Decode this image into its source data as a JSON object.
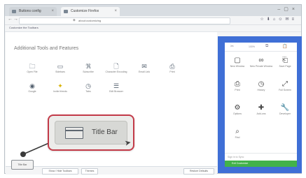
{
  "browser": {
    "tabs": [
      {
        "label": "Buttons config"
      },
      {
        "label": "Customize Firefox"
      }
    ],
    "url": "about:customizing",
    "bookmarks_label": "Customize the Toolbars"
  },
  "content": {
    "heading": "Additional Tools and Features",
    "items": [
      {
        "label": "Open File",
        "icon": "folder-icon",
        "glyph": "🗀"
      },
      {
        "label": "Sidebars",
        "icon": "sidebar-icon",
        "glyph": "▭"
      },
      {
        "label": "Subscribe",
        "icon": "rss-icon",
        "glyph": "ℜ"
      },
      {
        "label": "Character Encoding",
        "icon": "doc-icon",
        "glyph": "🗋"
      },
      {
        "label": "Email Link",
        "icon": "mail-icon",
        "glyph": "✉"
      },
      {
        "label": "Print",
        "icon": "print-icon",
        "glyph": "⎙"
      },
      {
        "label": "Google",
        "icon": "google-icon",
        "glyph": "◉"
      },
      {
        "label": "Invite friends",
        "icon": "light-icon",
        "glyph": "✦"
      },
      {
        "label": "Tabs",
        "icon": "history-icon",
        "glyph": "◷"
      },
      {
        "label": "Edit Browser",
        "icon": "list-icon",
        "glyph": "☰"
      }
    ]
  },
  "bottom": {
    "title_bar_button": "Title Bar",
    "show_hide_toolbars": "Show / Hide Toolbars",
    "themes": "Themes",
    "restore_defaults": "Restore Defaults"
  },
  "panel": {
    "top_icons": [
      "✂",
      "⧉",
      "📋"
    ],
    "top_label": "100%",
    "items": [
      {
        "label": "New Window",
        "icon": "window-icon",
        "glyph": "▢"
      },
      {
        "label": "New Private Window",
        "icon": "mask-icon",
        "glyph": "∞"
      },
      {
        "label": "Save Page",
        "icon": "save-icon",
        "glyph": "⎗"
      },
      {
        "label": "Print",
        "icon": "print-icon",
        "glyph": "⎙"
      },
      {
        "label": "History",
        "icon": "history-icon",
        "glyph": "◷"
      },
      {
        "label": "Full Screen",
        "icon": "fullscreen-icon",
        "glyph": "⤢"
      },
      {
        "label": "Options",
        "icon": "gear-icon",
        "glyph": "⚙"
      },
      {
        "label": "Add-ons",
        "icon": "puzzle-icon",
        "glyph": "✚"
      },
      {
        "label": "Developer",
        "icon": "wrench-icon",
        "glyph": "🔧"
      },
      {
        "label": "Find",
        "icon": "search-icon",
        "glyph": "⌕"
      }
    ],
    "footer": "Sign in to Sync",
    "green_button": "Exit Customize"
  },
  "callout": {
    "label": "Title Bar"
  },
  "colors": {
    "panel_bg": "#3f6fd6",
    "callout_border": "#c33a48",
    "exit_green": "#42b24a"
  }
}
